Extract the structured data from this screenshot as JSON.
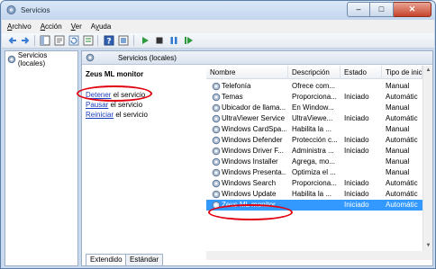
{
  "window": {
    "title": "Servicios"
  },
  "menu": [
    {
      "label": "Archivo",
      "accel": "A",
      "rest": "rchivo"
    },
    {
      "label": "Acción",
      "accel": "A",
      "rest": "cción"
    },
    {
      "label": "Ver",
      "accel": "V",
      "rest": "er"
    },
    {
      "label": "Ayuda",
      "accel": "y",
      "pre": "A",
      "rest": "uda"
    }
  ],
  "toolbar": {
    "buttons": [
      "back-icon",
      "forward-icon",
      "console-tree-icon",
      "properties-icon",
      "refresh-icon",
      "export-icon",
      "help-icon",
      "snapin-icon",
      "play-icon",
      "stop-icon",
      "pause-icon",
      "restart-icon"
    ]
  },
  "left_pane": {
    "item_label": "Servicios (locales)"
  },
  "right_pane": {
    "header_title": "Servicios (locales)",
    "selected_service": "Zeus ML monitor",
    "actions": {
      "stop_link": "Detener",
      "stop_suffix": " el servicio",
      "pause_link": "Pausar",
      "pause_suffix": " el servicio",
      "restart_link": "Reiniciar",
      "restart_suffix": " el servicio"
    },
    "tabs": {
      "extended": "Extendido",
      "standard": "Estándar"
    }
  },
  "services_table": {
    "columns": [
      "Nombre",
      "Descripción",
      "Estado",
      "Tipo de inic"
    ],
    "rows": [
      {
        "name": "Telefonía",
        "desc": "Ofrece com...",
        "status": "",
        "startup": "Manual"
      },
      {
        "name": "Temas",
        "desc": "Proporciona...",
        "status": "Iniciado",
        "startup": "Automátic"
      },
      {
        "name": "Ubicador de llama...",
        "desc": "En Window...",
        "status": "",
        "startup": "Manual"
      },
      {
        "name": "UltraViewer Service",
        "desc": "UltraViewe...",
        "status": "Iniciado",
        "startup": "Automátic"
      },
      {
        "name": "Windows CardSpa...",
        "desc": "Habilita la ...",
        "status": "",
        "startup": "Manual"
      },
      {
        "name": "Windows Defender",
        "desc": "Protección c...",
        "status": "Iniciado",
        "startup": "Automátic"
      },
      {
        "name": "Windows Driver F...",
        "desc": "Administra ...",
        "status": "Iniciado",
        "startup": "Manual"
      },
      {
        "name": "Windows Installer",
        "desc": "Agrega, mo...",
        "status": "",
        "startup": "Manual"
      },
      {
        "name": "Windows Presenta...",
        "desc": "Optimiza el ...",
        "status": "",
        "startup": "Manual"
      },
      {
        "name": "Windows Search",
        "desc": "Proporciona...",
        "status": "Iniciado",
        "startup": "Automátic"
      },
      {
        "name": "Windows Update",
        "desc": "Habilita la ...",
        "status": "Iniciado",
        "startup": "Automátic"
      },
      {
        "name": "Zeus ML monitor",
        "desc": "",
        "status": "Iniciado",
        "startup": "Automátic",
        "selected": true
      }
    ]
  },
  "colors": {
    "selection": "#3399ff",
    "annotation": "#e1000f",
    "link": "#1a3dc1"
  }
}
